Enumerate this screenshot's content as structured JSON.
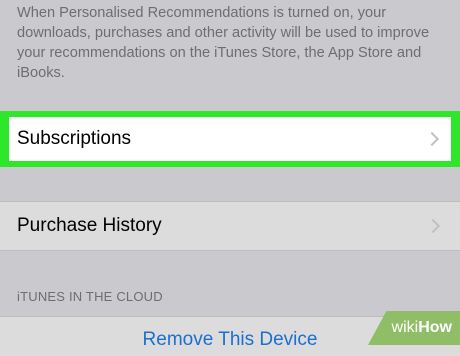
{
  "footer_note": "When Personalised Recommendations is turned on, your downloads, purchases and other activity will be used to improve your recommendations on the iTunes Store, the App Store and iBooks.",
  "rows": {
    "subscriptions": "Subscriptions",
    "purchase_history": "Purchase History"
  },
  "section_header": "iTUNES IN THE CLOUD",
  "remove_device": "Remove This Device",
  "watermark": {
    "prefix": "wiki",
    "suffix": "How"
  },
  "colors": {
    "highlight": "#2ee62a",
    "link": "#1a6fd0",
    "background": "#c9c9ce",
    "watermark": "#8fbe66"
  },
  "icons": {
    "row_disclosure": "chevron-right-icon"
  }
}
